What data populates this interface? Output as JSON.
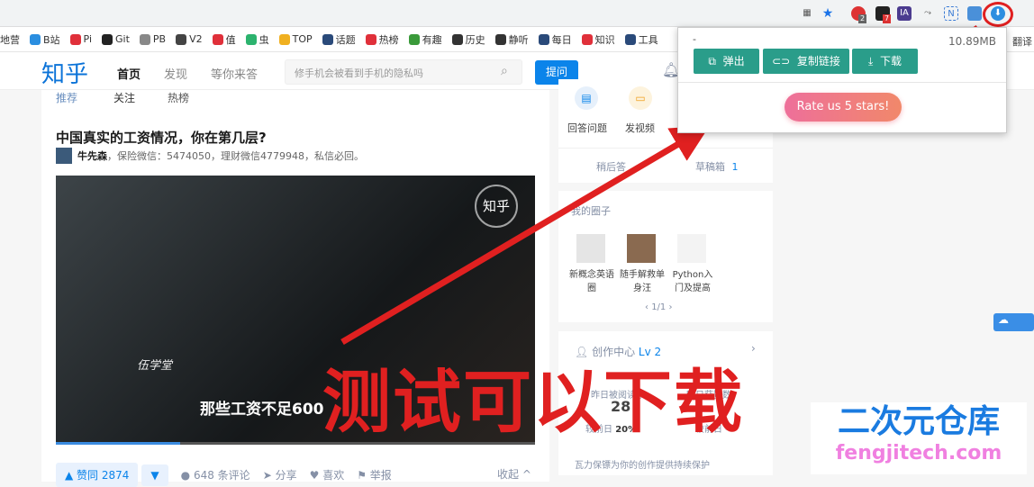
{
  "browser": {
    "toolbar_icons": [
      "qr-icon",
      "star-icon",
      "adblock-icon",
      "ext-icon",
      "ia-icon",
      "ext-icon",
      "notion-icon",
      "ext-icon",
      "downloader-icon"
    ],
    "badges": [
      "2",
      "7"
    ],
    "ext_labels": [
      "IA",
      "N"
    ]
  },
  "bookmarks": [
    {
      "label": "地营"
    },
    {
      "label": "B站"
    },
    {
      "label": "Pi"
    },
    {
      "label": "Git"
    },
    {
      "label": "PB"
    },
    {
      "label": "V2"
    },
    {
      "label": "值"
    },
    {
      "label": "虫"
    },
    {
      "label": "TOP"
    },
    {
      "label": "话题"
    },
    {
      "label": "热榜"
    },
    {
      "label": "有趣"
    },
    {
      "label": "历史"
    },
    {
      "label": "静听"
    },
    {
      "label": "每日"
    },
    {
      "label": "知识"
    },
    {
      "label": "工具"
    }
  ],
  "bookmark_right": "翻译",
  "header": {
    "logo": "知乎",
    "nav": [
      "首页",
      "发现",
      "等你来答"
    ],
    "search_placeholder": "修手机会被看到手机的隐私吗",
    "ask": "提问"
  },
  "feed": {
    "tabs": [
      "推荐",
      "关注",
      "热榜"
    ],
    "title": "中国真实的工资情况，你在第几层?",
    "author": "牛先森",
    "author_bio": "，保险微信：5474050，理财微信4779948，私信必回。",
    "video_watermark": "知乎",
    "video_subtitle": "那些工资不足600",
    "video_logo_text": "伍学堂",
    "progress_percent": 26,
    "actions": {
      "upvote": "▲ 赞同 2874",
      "downvote": "▼",
      "comments": "648 条评论",
      "share": "分享",
      "like": "喜欢",
      "report": "举报",
      "collapse": "收起 ^"
    }
  },
  "sidebar": {
    "create": [
      {
        "label": "回答问题"
      },
      {
        "label": "发视频"
      }
    ],
    "later": "稍后答",
    "drafts": "草稿箱",
    "drafts_count": "1",
    "circles_title": "我的圈子",
    "circles": [
      {
        "label": "新概念英语圈"
      },
      {
        "label": "随手解救单身汪"
      },
      {
        "label": "Python入门及提高"
      }
    ],
    "pager": "1/1",
    "creator_title": "创作中心",
    "creator_level": "Lv 2",
    "stats": [
      {
        "label": "昨日被阅读数",
        "value": "28",
        "delta_label": "较前日",
        "delta": "20%"
      },
      {
        "label": "昨日获赞数",
        "value": "",
        "delta_label": "较前日",
        "delta": "--"
      }
    ],
    "protect": "瓦力保镖为你的创作提供持续保护"
  },
  "popup": {
    "title": "-",
    "size": "10.89MB",
    "buttons": [
      {
        "label": "弹出",
        "icon": "external-link-icon"
      },
      {
        "label": "复制链接",
        "icon": "link-icon"
      },
      {
        "label": "下载",
        "icon": "download-icon"
      }
    ],
    "rate": "Rate us 5 stars!"
  },
  "overlay": {
    "text": "测试可以下载",
    "watermark_cn": "二次元仓库",
    "watermark_url": "fengjitech.com"
  },
  "colors": {
    "zhihu_blue": "#0b84ea",
    "popup_button": "#2a9d8a",
    "annotation_red": "#e02020"
  }
}
